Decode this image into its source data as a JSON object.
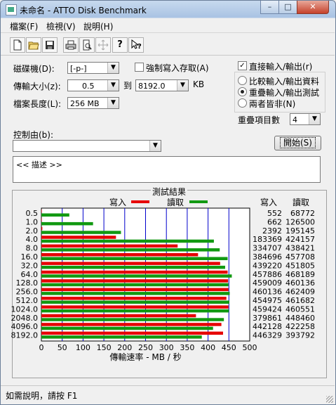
{
  "window": {
    "title": "未命名 - ATTO Disk Benchmark",
    "min_glyph": "–",
    "max_glyph": "□",
    "close_glyph": "✕"
  },
  "menu": [
    {
      "label": "檔案(F)"
    },
    {
      "label": "檢視(V)"
    },
    {
      "label": "說明(H)"
    }
  ],
  "toolbar": {
    "icons": [
      "new-icon",
      "open-icon",
      "save-icon",
      "print-icon",
      "print-preview-icon",
      "move-icon",
      "help-icon",
      "context-help-icon"
    ]
  },
  "settings": {
    "drive_label": "磁碟機(D):",
    "drive_value": "[-p-]",
    "force_write_label": "強制寫入存取(A)",
    "force_write_checked": false,
    "transfer_label": "傳輸大小(z):",
    "transfer_from": "0.5",
    "to_label": "到",
    "transfer_to": "8192.0",
    "kb_label": "KB",
    "file_length_label": "檔案長度(L):",
    "file_length_value": "256 MB",
    "direct_io_label": "直接輸入/輸出(r)",
    "direct_io_checked": true,
    "radio_compare": "比較輸入/輸出資料",
    "radio_overlap": "重疊輸入/輸出測試",
    "radio_neither": "兩者皆非(N)",
    "selected_radio": "overlap",
    "queue_label": "重疊項目數",
    "queue_value": "4",
    "control_label": "控制由(b):",
    "control_value": "",
    "start_label": "開始(S)",
    "description": "<< 描述 >>"
  },
  "results": {
    "group_title": "測試結果",
    "write_legend": "寫入",
    "read_legend": "讀取",
    "write_header": "寫入",
    "read_header": "讀取",
    "write_color": "#e60000",
    "read_color": "#119911"
  },
  "chart_data": {
    "type": "bar",
    "orientation": "horizontal",
    "title": "測試結果",
    "xlabel": "傳輸速率 - MB / 秒",
    "xlim": [
      0,
      500
    ],
    "xticks": [
      0,
      50,
      100,
      150,
      200,
      250,
      300,
      350,
      400,
      450,
      500
    ],
    "categories": [
      "0.5",
      "1.0",
      "2.0",
      "4.0",
      "8.0",
      "16.0",
      "32.0",
      "64.0",
      "128.0",
      "256.0",
      "512.0",
      "1024.0",
      "2048.0",
      "4096.0",
      "8192.0"
    ],
    "series": [
      {
        "name": "寫入",
        "values_kb": [
          "552",
          "662",
          "2392",
          "183369",
          "334707",
          "384696",
          "439220",
          "457886",
          "459009",
          "460136",
          "454975",
          "459424",
          "379861",
          "442128",
          "446329"
        ],
        "values": [
          0.5,
          0.6,
          2.3,
          179,
          327,
          376,
          429,
          447,
          448,
          449,
          444,
          449,
          371,
          432,
          436
        ]
      },
      {
        "name": "讀取",
        "values_kb": [
          "68772",
          "126500",
          "195145",
          "424157",
          "438421",
          "457708",
          "451805",
          "468189",
          "460136",
          "462409",
          "461682",
          "460551",
          "448460",
          "422258",
          "393792"
        ],
        "values": [
          67,
          124,
          191,
          414,
          428,
          447,
          441,
          457,
          449,
          452,
          451,
          450,
          438,
          412,
          385
        ]
      }
    ],
    "grid": true,
    "legend": "top"
  },
  "status": {
    "text": "如需說明，請按 F1"
  }
}
